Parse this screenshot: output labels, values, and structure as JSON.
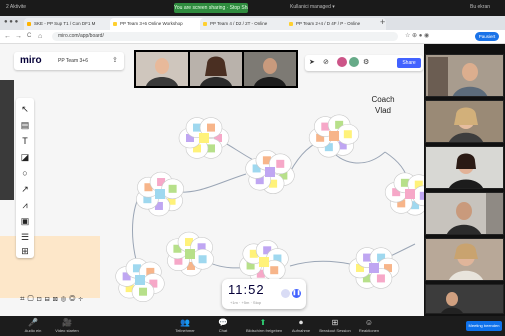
{
  "os_bar": {
    "recording": "You are screen sharing · Stop Share",
    "left_text": "2  Aktivite",
    "mid_text": "Kullanici managed ▾",
    "right_text": "Bu ekran"
  },
  "browser": {
    "tabs": [
      {
        "label": "SKE - PP Sup T1 / Con DF1 M",
        "color": "#ffb300"
      },
      {
        "label": "PP Team 3+6 Online Workshop",
        "color": "#ffd02f"
      },
      {
        "label": "PP Team 4 / D2 / 2T - Online",
        "color": "#ffd02f"
      },
      {
        "label": "PP Team 2+4 / D 4F / P - Online",
        "color": "#ffd02f"
      }
    ],
    "url": "miro.com/app/board/",
    "nav": [
      "←",
      "→",
      "C",
      "⌂"
    ],
    "profile": "Pausiert"
  },
  "miro": {
    "logo": "miro",
    "board_name": "PP Team 3+6",
    "share": "Share",
    "coach_label": "Coach Vlad"
  },
  "timer": {
    "value": "11:52",
    "sub": "+1m · +5m · Stop"
  },
  "zoom_toolbar": {
    "buttons": [
      {
        "label": "Audio ein",
        "glyph": "🎤"
      },
      {
        "label": "Video starten",
        "glyph": "🎥"
      },
      {
        "label": "Teilnehmer",
        "glyph": "👥"
      },
      {
        "label": "Chat",
        "glyph": "💬"
      },
      {
        "label": "Bildschirm freigeben",
        "glyph": "⬆"
      },
      {
        "label": "Aufnahme",
        "glyph": "⏺"
      },
      {
        "label": "Breakout Session",
        "glyph": "⊞"
      },
      {
        "label": "Reaktionen",
        "glyph": "☺"
      }
    ],
    "end": "Meeting beenden"
  },
  "colors": {
    "miro_blue": "#4262ff",
    "zoom_blue": "#0e71eb",
    "rec_green": "#2e8b3e"
  }
}
